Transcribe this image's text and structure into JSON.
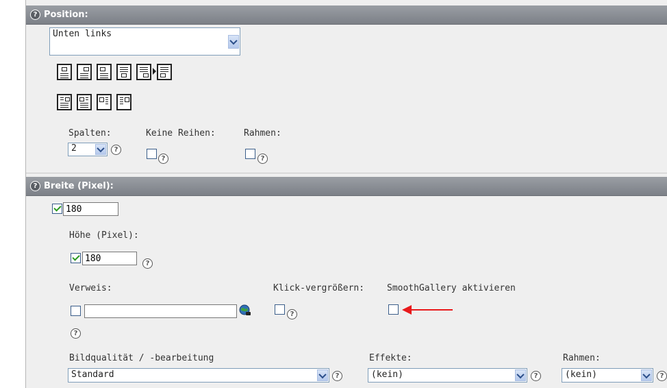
{
  "position_section": {
    "header": "Position:",
    "position_select_value": "Unten links",
    "columns_label": "Spalten:",
    "columns_value": "2",
    "no_rows_label": "Keine Reihen:",
    "border_label": "Rahmen:"
  },
  "width_section": {
    "header": "Breite (Pixel):",
    "width_value": "180",
    "width_checked": true,
    "height_label": "Höhe (Pixel):",
    "height_value": "180",
    "height_checked": true,
    "link_label": "Verweis:",
    "link_value": "",
    "click_enlarge_label": "Klick-vergrößern:",
    "smoothgallery_label": "SmoothGallery aktivieren",
    "quality_label": "Bildqualität / -bearbeitung",
    "quality_value": "Standard",
    "effects_label": "Effekte:",
    "effects_value": "(kein)",
    "frame_label": "Rahmen:",
    "frame_value": "(kein)"
  },
  "icons": {
    "help": "help-icon",
    "link_browser": "globe-link-icon",
    "annotation": "red-arrow-icon"
  },
  "help_glyph": "?",
  "colors": {
    "header_bg": "#8a8e94",
    "check": "#2a9a1f",
    "arrow": "#e8191b"
  }
}
